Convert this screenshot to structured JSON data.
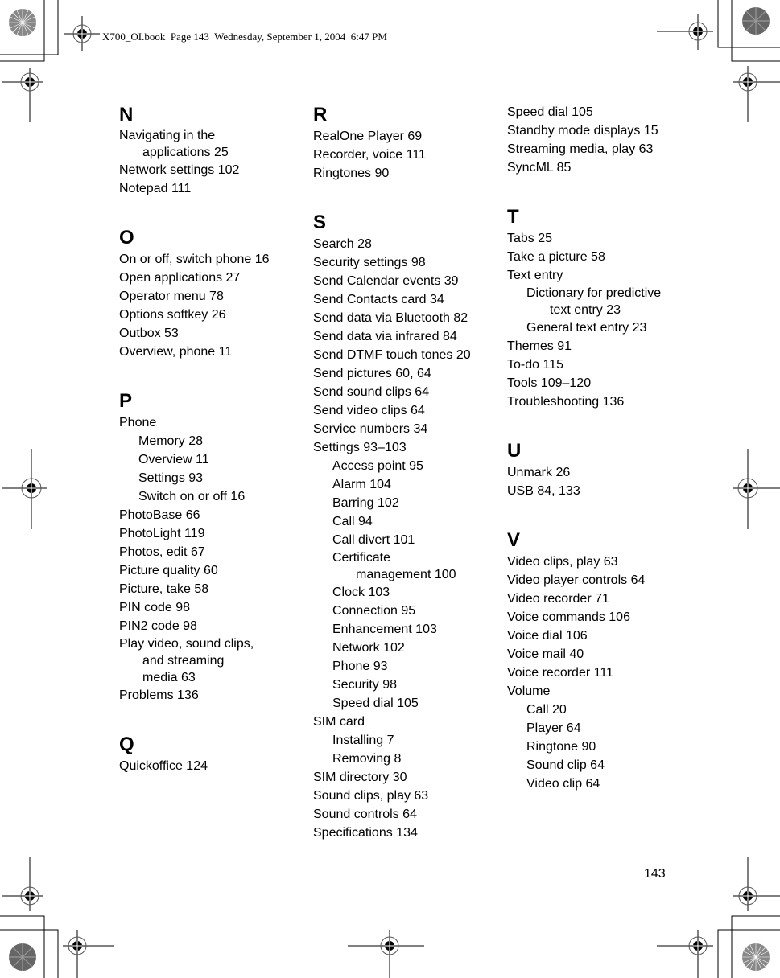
{
  "header": {
    "slug_line": "X700_OI.book  Page 143  Wednesday, September 1, 2004  6:47 PM"
  },
  "index": {
    "columns": [
      {
        "sections": [
          {
            "letter": "N",
            "entries": [
              {
                "text": "Navigating in the",
                "cont": "applications 25",
                "level": 0
              },
              {
                "text": "Network settings 102",
                "level": 0
              },
              {
                "text": "Notepad 111",
                "level": 0
              }
            ]
          },
          {
            "letter": "O",
            "entries": [
              {
                "text": "On or off, switch phone 16",
                "level": 0
              },
              {
                "text": "Open applications 27",
                "level": 0
              },
              {
                "text": "Operator menu 78",
                "level": 0
              },
              {
                "text": "Options softkey 26",
                "level": 0
              },
              {
                "text": "Outbox 53",
                "level": 0
              },
              {
                "text": "Overview, phone 11",
                "level": 0
              }
            ]
          },
          {
            "letter": "P",
            "entries": [
              {
                "text": "Phone",
                "level": 0
              },
              {
                "text": "Memory 28",
                "level": 1
              },
              {
                "text": "Overview 11",
                "level": 1
              },
              {
                "text": "Settings 93",
                "level": 1
              },
              {
                "text": "Switch on or off 16",
                "level": 1
              },
              {
                "text": "PhotoBase 66",
                "level": 0
              },
              {
                "text": "PhotoLight 119",
                "level": 0
              },
              {
                "text": "Photos, edit 67",
                "level": 0
              },
              {
                "text": "Picture quality 60",
                "level": 0
              },
              {
                "text": "Picture, take 58",
                "level": 0
              },
              {
                "text": "PIN code 98",
                "level": 0
              },
              {
                "text": "PIN2 code 98",
                "level": 0
              },
              {
                "text": "Play video, sound clips,",
                "cont": "and streaming",
                "cont2": "media 63",
                "level": 0
              },
              {
                "text": "Problems 136",
                "level": 0
              }
            ]
          },
          {
            "letter": "Q",
            "entries": [
              {
                "text": "Quickoffice 124",
                "level": 0
              }
            ]
          }
        ]
      },
      {
        "sections": [
          {
            "letter": "R",
            "entries": [
              {
                "text": "RealOne Player 69",
                "level": 0
              },
              {
                "text": "Recorder, voice 111",
                "level": 0
              },
              {
                "text": "Ringtones 90",
                "level": 0
              }
            ]
          },
          {
            "letter": "S",
            "entries": [
              {
                "text": "Search 28",
                "level": 0
              },
              {
                "text": "Security settings 98",
                "level": 0
              },
              {
                "text": "Send Calendar events 39",
                "level": 0
              },
              {
                "text": "Send Contacts card 34",
                "level": 0
              },
              {
                "text": "Send data via Bluetooth 82",
                "level": 0
              },
              {
                "text": "Send data via infrared 84",
                "level": 0
              },
              {
                "text": "Send DTMF touch tones 20",
                "level": 0
              },
              {
                "text": "Send pictures 60, 64",
                "level": 0
              },
              {
                "text": "Send sound clips 64",
                "level": 0
              },
              {
                "text": "Send video clips 64",
                "level": 0
              },
              {
                "text": "Service numbers 34",
                "level": 0
              },
              {
                "text": "Settings 93–103",
                "level": 0
              },
              {
                "text": "Access point 95",
                "level": 1
              },
              {
                "text": "Alarm 104",
                "level": 1
              },
              {
                "text": "Barring 102",
                "level": 1
              },
              {
                "text": "Call 94",
                "level": 1
              },
              {
                "text": "Call divert 101",
                "level": 1
              },
              {
                "text": "Certificate",
                "cont": "management 100",
                "level": 1
              },
              {
                "text": "Clock 103",
                "level": 1
              },
              {
                "text": "Connection 95",
                "level": 1
              },
              {
                "text": "Enhancement 103",
                "level": 1
              },
              {
                "text": "Network 102",
                "level": 1
              },
              {
                "text": "Phone 93",
                "level": 1
              },
              {
                "text": "Security 98",
                "level": 1
              },
              {
                "text": "Speed dial 105",
                "level": 1
              },
              {
                "text": "SIM card",
                "level": 0
              },
              {
                "text": "Installing 7",
                "level": 1
              },
              {
                "text": "Removing 8",
                "level": 1
              },
              {
                "text": "SIM directory 30",
                "level": 0
              },
              {
                "text": "Sound clips, play 63",
                "level": 0
              },
              {
                "text": "Sound controls 64",
                "level": 0
              },
              {
                "text": "Specifications 134",
                "level": 0
              }
            ]
          }
        ]
      },
      {
        "sections": [
          {
            "letter": "",
            "entries": [
              {
                "text": "Speed dial 105",
                "level": 0
              },
              {
                "text": "Standby mode displays 15",
                "level": 0
              },
              {
                "text": "Streaming media, play 63",
                "level": 0
              },
              {
                "text": "SyncML 85",
                "level": 0
              }
            ]
          },
          {
            "letter": "T",
            "entries": [
              {
                "text": "Tabs 25",
                "level": 0
              },
              {
                "text": "Take a picture 58",
                "level": 0
              },
              {
                "text": "Text entry",
                "level": 0
              },
              {
                "text": "Dictionary for predictive",
                "cont": "text entry 23",
                "level": 1
              },
              {
                "text": "General text entry 23",
                "level": 1
              },
              {
                "text": "Themes 91",
                "level": 0
              },
              {
                "text": "To-do 115",
                "level": 0
              },
              {
                "text": "Tools 109–120",
                "level": 0
              },
              {
                "text": "Troubleshooting 136",
                "level": 0
              }
            ]
          },
          {
            "letter": "U",
            "entries": [
              {
                "text": "Unmark 26",
                "level": 0
              },
              {
                "text": "USB 84, 133",
                "level": 0
              }
            ]
          },
          {
            "letter": "V",
            "entries": [
              {
                "text": "Video clips, play 63",
                "level": 0
              },
              {
                "text": "Video player controls 64",
                "level": 0
              },
              {
                "text": "Video recorder 71",
                "level": 0
              },
              {
                "text": "Voice commands 106",
                "level": 0
              },
              {
                "text": "Voice dial 106",
                "level": 0
              },
              {
                "text": "Voice mail 40",
                "level": 0
              },
              {
                "text": "Voice recorder 111",
                "level": 0
              },
              {
                "text": "Volume",
                "level": 0
              },
              {
                "text": "Call 20",
                "level": 1
              },
              {
                "text": "Player 64",
                "level": 1
              },
              {
                "text": "Ringtone 90",
                "level": 1
              },
              {
                "text": "Sound clip 64",
                "level": 1
              },
              {
                "text": "Video clip 64",
                "level": 1
              }
            ]
          }
        ]
      }
    ]
  },
  "footer": {
    "page_number": "143"
  }
}
